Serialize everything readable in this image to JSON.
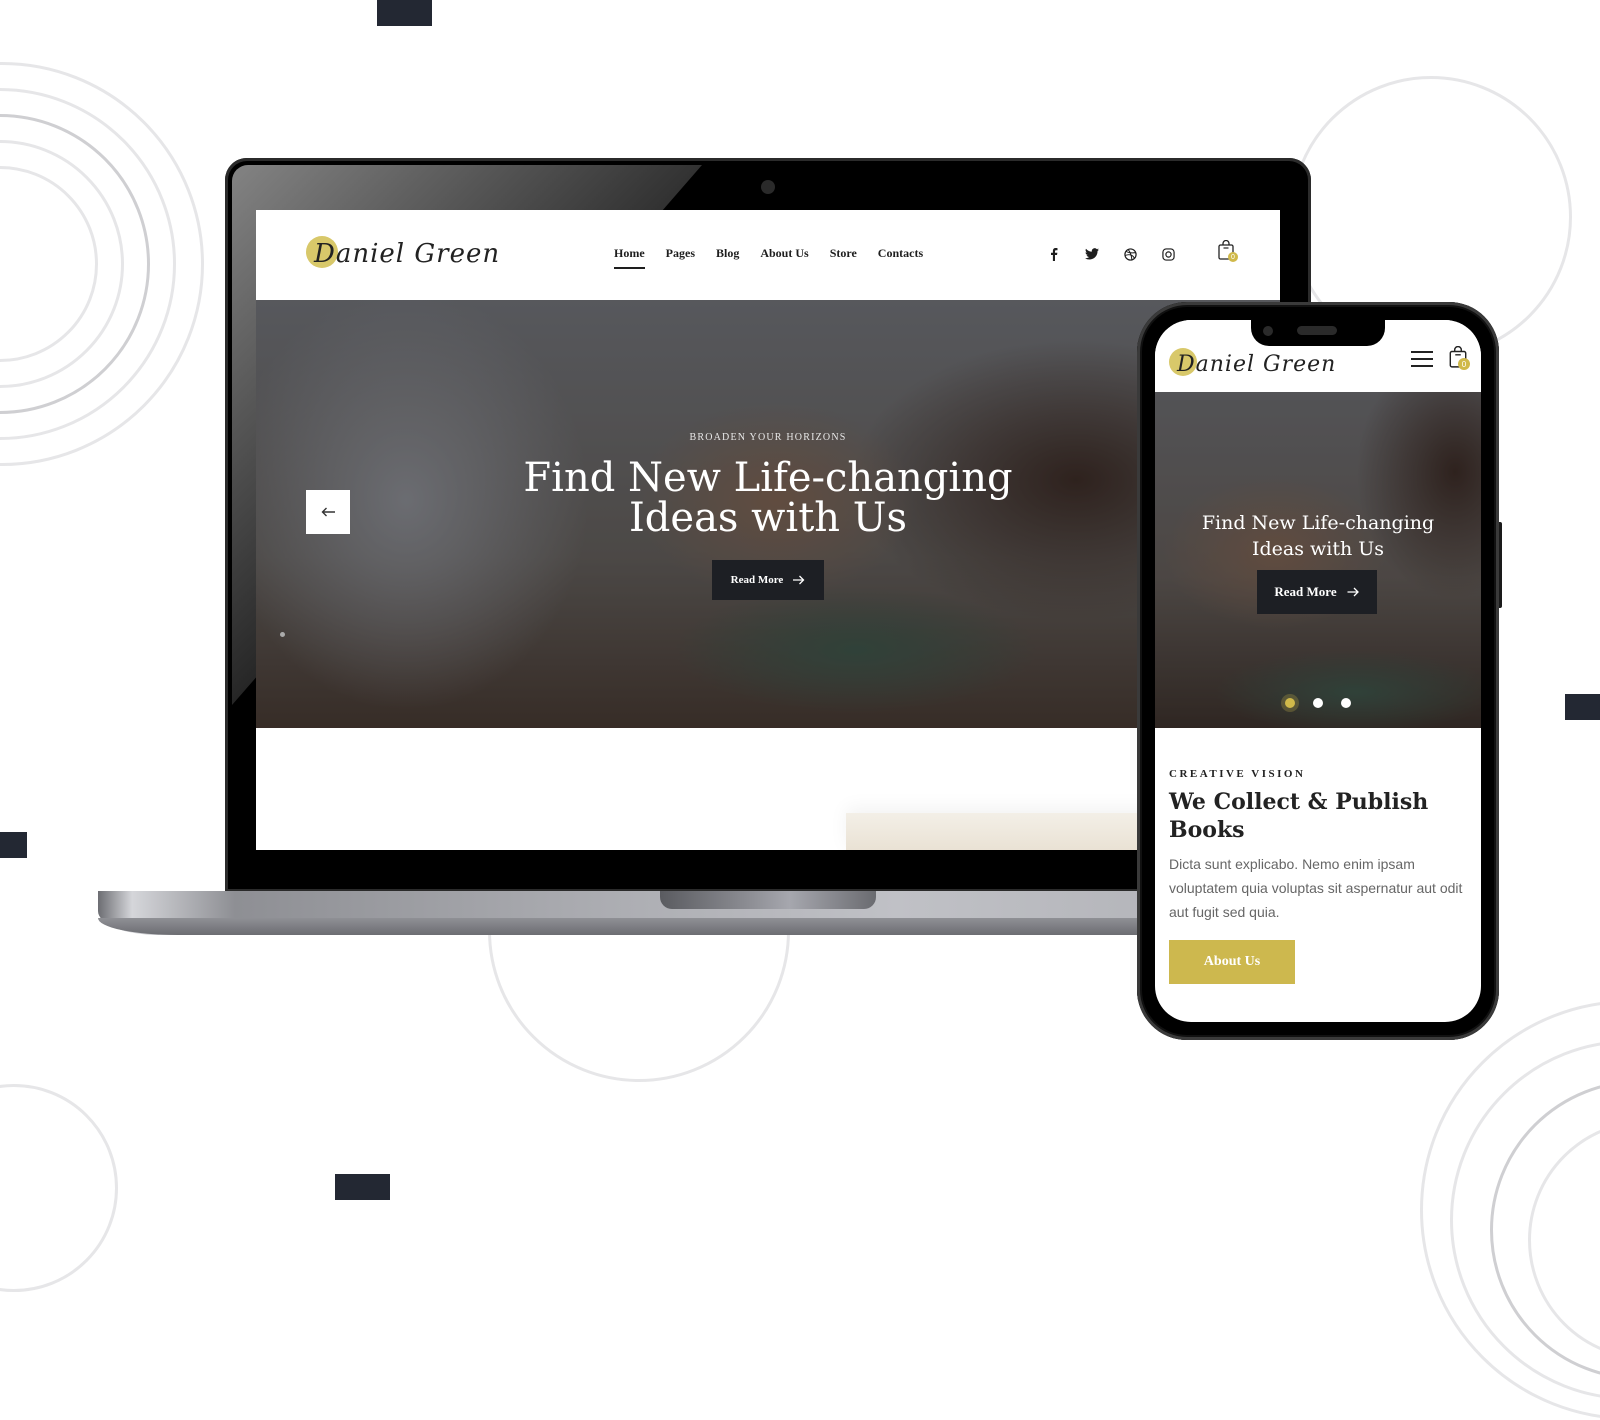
{
  "brand": {
    "logo_text": "Daniel Green",
    "accent_color": "#d0b94a",
    "dark_color": "#1d1f24"
  },
  "desktop": {
    "nav": {
      "items": [
        {
          "label": "Home",
          "active": true
        },
        {
          "label": "Pages",
          "active": false
        },
        {
          "label": "Blog",
          "active": false
        },
        {
          "label": "About Us",
          "active": false
        },
        {
          "label": "Store",
          "active": false
        },
        {
          "label": "Contacts",
          "active": false
        }
      ]
    },
    "social": [
      "facebook-icon",
      "twitter-icon",
      "dribbble-icon",
      "instagram-icon"
    ],
    "cart": {
      "count": "0"
    },
    "hero": {
      "eyebrow": "BROADEN YOUR HORIZONS",
      "title_line1": "Find New Life-changing",
      "title_line2": "Ideas with Us",
      "button_label": "Read More",
      "prev_arrow": "←"
    }
  },
  "mobile": {
    "cart": {
      "count": "0"
    },
    "hero": {
      "title_line1": "Find New Life-changing",
      "title_line2": "Ideas with Us",
      "button_label": "Read More",
      "slides": 3,
      "active_slide": 1
    },
    "section": {
      "eyebrow": "CREATIVE VISION",
      "title": "We Collect & Publish Books",
      "text": "Dicta sunt explicabo. Nemo enim ipsam voluptatem quia voluptas sit aspernatur aut odit aut fugit sed quia.",
      "button_label": "About Us"
    }
  }
}
